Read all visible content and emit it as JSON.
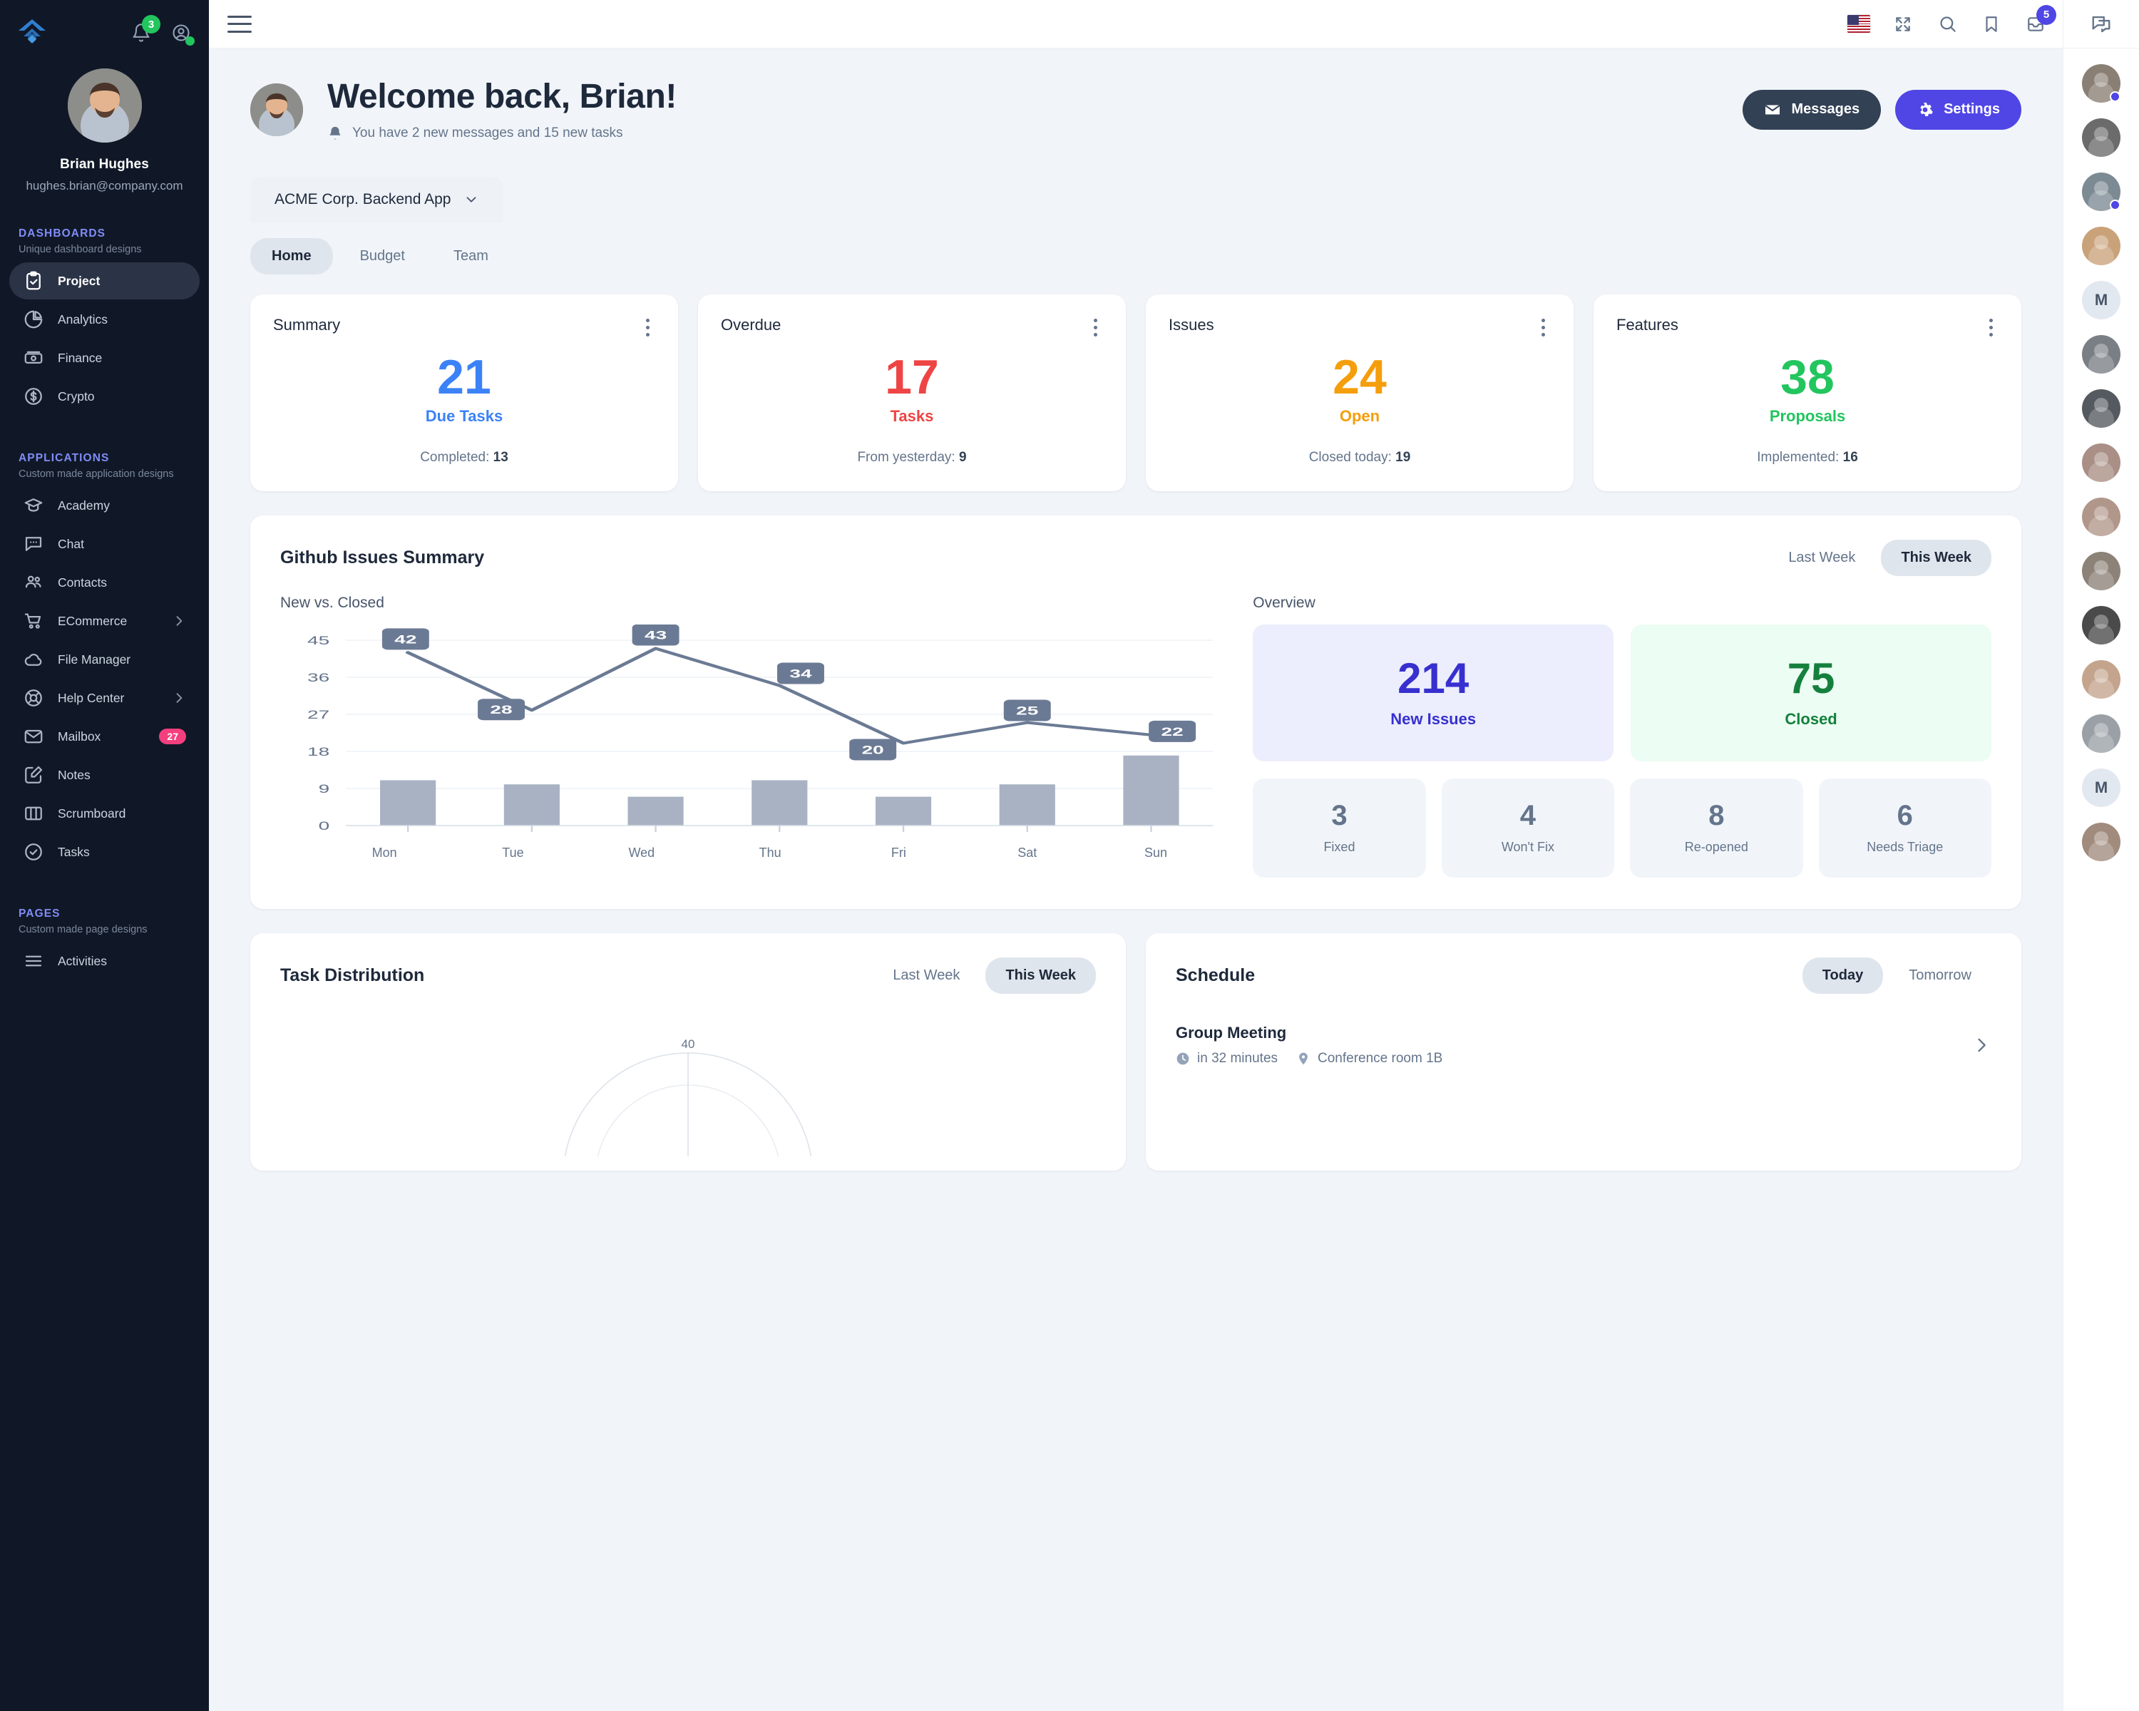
{
  "sidebar": {
    "logo": "fuse-logo",
    "notifications_badge": "3",
    "user": {
      "name": "Brian Hughes",
      "email": "hughes.brian@company.com"
    },
    "sections": [
      {
        "title": "DASHBOARDS",
        "subtitle": "Unique dashboard designs",
        "items": [
          {
            "label": "Project",
            "icon": "clipboard-check-icon",
            "active": true
          },
          {
            "label": "Analytics",
            "icon": "pie-chart-icon",
            "active": false
          },
          {
            "label": "Finance",
            "icon": "banknote-icon",
            "active": false
          },
          {
            "label": "Crypto",
            "icon": "dollar-circle-icon",
            "active": false
          }
        ]
      },
      {
        "title": "APPLICATIONS",
        "subtitle": "Custom made application designs",
        "items": [
          {
            "label": "Academy",
            "icon": "graduation-cap-icon",
            "active": false
          },
          {
            "label": "Chat",
            "icon": "chat-bubble-icon",
            "active": false
          },
          {
            "label": "Contacts",
            "icon": "users-icon",
            "active": false
          },
          {
            "label": "ECommerce",
            "icon": "shopping-cart-icon",
            "active": false,
            "chevron": true
          },
          {
            "label": "File Manager",
            "icon": "cloud-icon",
            "active": false
          },
          {
            "label": "Help Center",
            "icon": "lifebuoy-icon",
            "active": false,
            "chevron": true
          },
          {
            "label": "Mailbox",
            "icon": "envelope-icon",
            "active": false,
            "badge": "27"
          },
          {
            "label": "Notes",
            "icon": "pencil-square-icon",
            "active": false
          },
          {
            "label": "Scrumboard",
            "icon": "columns-icon",
            "active": false
          },
          {
            "label": "Tasks",
            "icon": "check-circle-icon",
            "active": false
          }
        ]
      },
      {
        "title": "PAGES",
        "subtitle": "Custom made page designs",
        "items": [
          {
            "label": "Activities",
            "icon": "list-icon",
            "active": false
          }
        ]
      }
    ]
  },
  "topbar": {
    "menu_icon": "hamburger-icon",
    "icons": [
      {
        "name": "language-flag-us"
      },
      {
        "name": "fullscreen-icon"
      },
      {
        "name": "search-icon"
      },
      {
        "name": "bookmark-icon"
      },
      {
        "name": "inbox-icon",
        "badge": "5"
      }
    ],
    "chat_panel_icon": "chat-panel-icon"
  },
  "hero": {
    "title": "Welcome back, Brian!",
    "subtitle": "You have 2 new messages and 15 new tasks",
    "bell_icon": "bell-icon",
    "messages_button": "Messages",
    "messages_icon": "envelope-icon",
    "settings_button": "Settings",
    "settings_icon": "gear-icon"
  },
  "project_tab": {
    "label": "ACME Corp. Backend App",
    "chevron": "chevron-down-icon"
  },
  "subtabs": [
    {
      "label": "Home",
      "active": true
    },
    {
      "label": "Budget",
      "active": false
    },
    {
      "label": "Team",
      "active": false
    }
  ],
  "stat_cards": [
    {
      "title": "Summary",
      "value": "21",
      "label": "Due Tasks",
      "foot_label": "Completed:",
      "foot_value": "13",
      "color": "#3b82f6"
    },
    {
      "title": "Overdue",
      "value": "17",
      "label": "Tasks",
      "foot_label": "From yesterday:",
      "foot_value": "9",
      "color": "#ef4444"
    },
    {
      "title": "Issues",
      "value": "24",
      "label": "Open",
      "foot_label": "Closed today:",
      "foot_value": "19",
      "color": "#f59e0b"
    },
    {
      "title": "Features",
      "value": "38",
      "label": "Proposals",
      "foot_label": "Implemented:",
      "foot_value": "16",
      "color": "#22c55e"
    }
  ],
  "github": {
    "title": "Github Issues Summary",
    "toggle": [
      {
        "label": "Last Week",
        "active": false
      },
      {
        "label": "This Week",
        "active": true
      }
    ],
    "left_title": "New vs. Closed",
    "right_title": "Overview",
    "overview_big": [
      {
        "value": "214",
        "label": "New Issues",
        "variant": "blue"
      },
      {
        "value": "75",
        "label": "Closed",
        "variant": "green"
      }
    ],
    "overview_small": [
      {
        "value": "3",
        "label": "Fixed"
      },
      {
        "value": "4",
        "label": "Won't Fix"
      },
      {
        "value": "8",
        "label": "Re-opened"
      },
      {
        "value": "6",
        "label": "Needs Triage"
      }
    ]
  },
  "chart_data": {
    "type": "bar",
    "title": "New vs. Closed",
    "categories": [
      "Mon",
      "Tue",
      "Wed",
      "Thu",
      "Fri",
      "Sat",
      "Sun"
    ],
    "series": [
      {
        "name": "New",
        "type": "line",
        "values": [
          42,
          28,
          43,
          34,
          20,
          25,
          22
        ]
      },
      {
        "name": "Closed",
        "type": "bar",
        "values": [
          11,
          10,
          7,
          11,
          7,
          10,
          17
        ]
      }
    ],
    "xlabel": "",
    "ylabel": "",
    "ylim": [
      0,
      45
    ],
    "yticks": [
      0,
      9,
      18,
      27,
      36,
      45
    ],
    "grid": true,
    "legend": "none"
  },
  "task_distribution": {
    "title": "Task Distribution",
    "toggle": [
      {
        "label": "Last Week",
        "active": false
      },
      {
        "label": "This Week",
        "active": true
      }
    ],
    "radar_top_tick": "40"
  },
  "schedule": {
    "title": "Schedule",
    "toggle": [
      {
        "label": "Today",
        "active": true
      },
      {
        "label": "Tomorrow",
        "active": false
      }
    ],
    "items": [
      {
        "name": "Group Meeting",
        "time": "in 32 minutes",
        "location": "Conference room 1B",
        "clock_icon": "clock-icon",
        "pin_icon": "map-pin-icon",
        "chevron": "chevron-right-icon"
      }
    ]
  },
  "contacts_rail": [
    {
      "initial": "",
      "photo": "#8a7f74",
      "status": "#4f46e5"
    },
    {
      "initial": "",
      "photo": "#6b6b6b",
      "status": ""
    },
    {
      "initial": "",
      "photo": "#7c8a94",
      "status": "#4f46e5"
    },
    {
      "initial": "",
      "photo": "#c9a27a",
      "status": ""
    },
    {
      "initial": "M",
      "photo": "",
      "status": ""
    },
    {
      "initial": "",
      "photo": "#7a7f86",
      "status": ""
    },
    {
      "initial": "",
      "photo": "#555a60",
      "status": ""
    },
    {
      "initial": "",
      "photo": "#a98f85",
      "status": ""
    },
    {
      "initial": "",
      "photo": "#b1968a",
      "status": ""
    },
    {
      "initial": "",
      "photo": "#8c8278",
      "status": ""
    },
    {
      "initial": "",
      "photo": "#4a4a4a",
      "status": ""
    },
    {
      "initial": "",
      "photo": "#c4a48d",
      "status": ""
    },
    {
      "initial": "",
      "photo": "#9aa0a6",
      "status": ""
    },
    {
      "initial": "M",
      "photo": "",
      "status": ""
    },
    {
      "initial": "",
      "photo": "#a08b7d",
      "status": ""
    }
  ],
  "colors": {
    "accent": "#4f46e5",
    "sidebar_bg": "#101827",
    "page_bg": "#f1f5f9"
  }
}
